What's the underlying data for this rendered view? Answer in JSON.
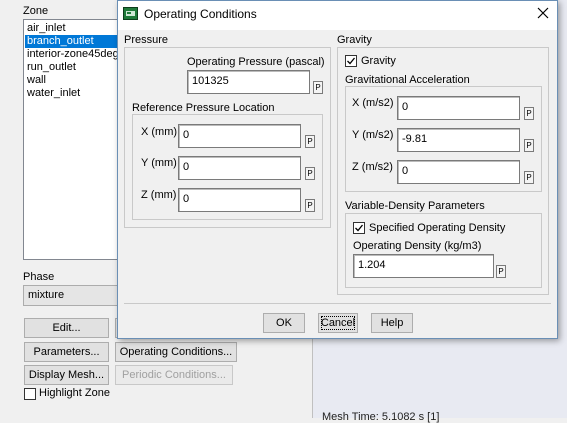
{
  "zone": {
    "label": "Zone",
    "items": [
      "air_inlet",
      "branch_outlet",
      "interior-zone45deg",
      "run_outlet",
      "wall",
      "water_inlet"
    ],
    "selected_index": 1
  },
  "phase": {
    "label": "Phase",
    "value": "mixture"
  },
  "left_buttons": {
    "edit": "Edit...",
    "parameters": "Parameters...",
    "operating_conditions": "Operating Conditions...",
    "display_mesh": "Display Mesh...",
    "periodic_conditions": "Periodic Conditions...",
    "highlight_zone": "Highlight Zone"
  },
  "dialog": {
    "title": "Operating Conditions",
    "pressure": {
      "label": "Pressure",
      "operating_pressure_label": "Operating Pressure (pascal)",
      "operating_pressure_value": "101325",
      "reference_location_label": "Reference Pressure Location",
      "x_label": "X (mm)",
      "x_value": "0",
      "y_label": "Y (mm)",
      "y_value": "0",
      "z_label": "Z (mm)",
      "z_value": "0"
    },
    "gravity": {
      "label": "Gravity",
      "checkbox_label": "Gravity",
      "checked": true,
      "acceleration_label": "Gravitational Acceleration",
      "x_label": "X (m/s2)",
      "x_value": "0",
      "y_label": "Y (m/s2)",
      "y_value": "-9.81",
      "z_label": "Z (m/s2)",
      "z_value": "0"
    },
    "variable_density": {
      "label": "Variable-Density Parameters",
      "specified_label": "Specified Operating Density",
      "specified_checked": true,
      "density_label": "Operating Density (kg/m3)",
      "density_value": "1.204"
    },
    "param_button": "P",
    "buttons": {
      "ok": "OK",
      "cancel": "Cancel",
      "help": "Help"
    }
  },
  "background_text": "Mesh  Time: 5.1082 s [1]",
  "colors": {
    "selection": "#0078d7",
    "background_panel": "#e8eaf2"
  }
}
